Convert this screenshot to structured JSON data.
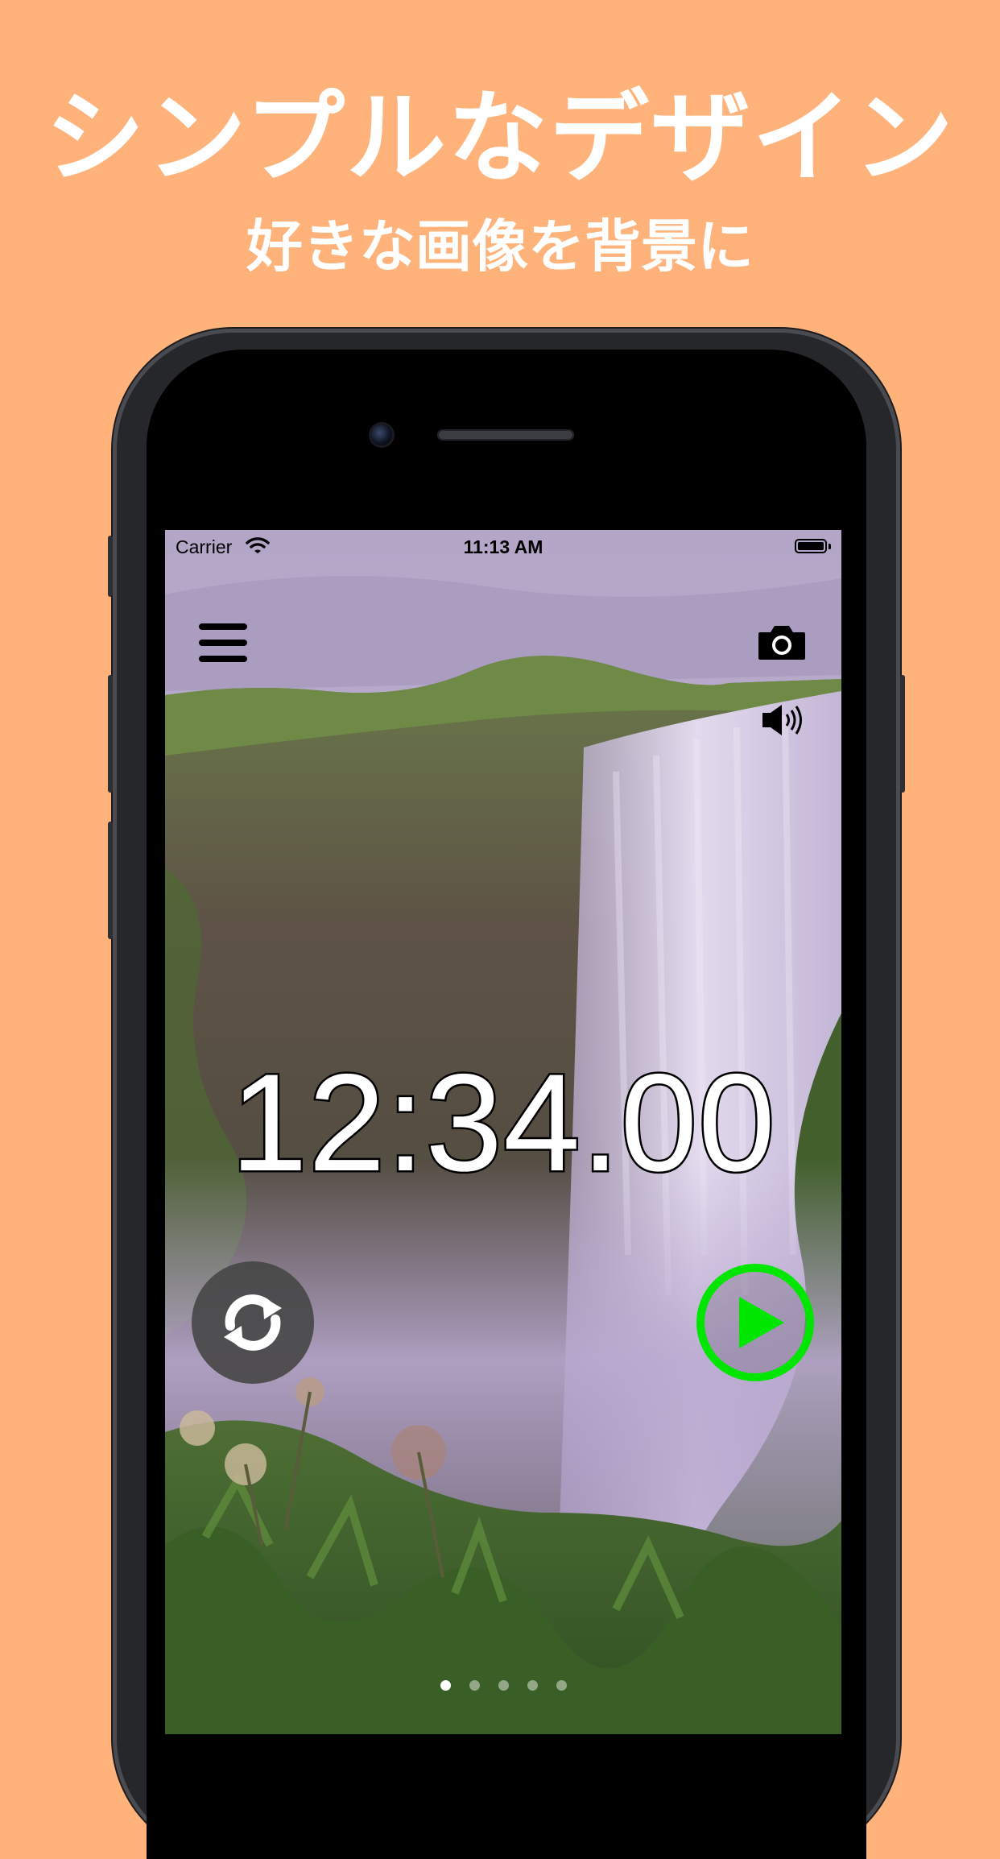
{
  "promo": {
    "headline": "シンプルなデザイン",
    "subheadline": "好きな画像を背景に",
    "background_color": "#FFB27A"
  },
  "status_bar": {
    "carrier": "Carrier",
    "time": "11:13 AM",
    "wifi_icon": "wifi-icon",
    "battery_icon": "battery-icon"
  },
  "toolbar": {
    "menu_icon": "hamburger-menu-icon",
    "camera_icon": "camera-icon",
    "sound_icon": "speaker-volume-icon"
  },
  "timer": {
    "display": "12:34.00",
    "text_color": "#ffffff",
    "outline_color": "#000000"
  },
  "controls": {
    "reset_icon": "refresh-icon",
    "play_icon": "play-icon",
    "play_color": "#00e600"
  },
  "pager": {
    "page_count": 5,
    "active_index": 0
  }
}
